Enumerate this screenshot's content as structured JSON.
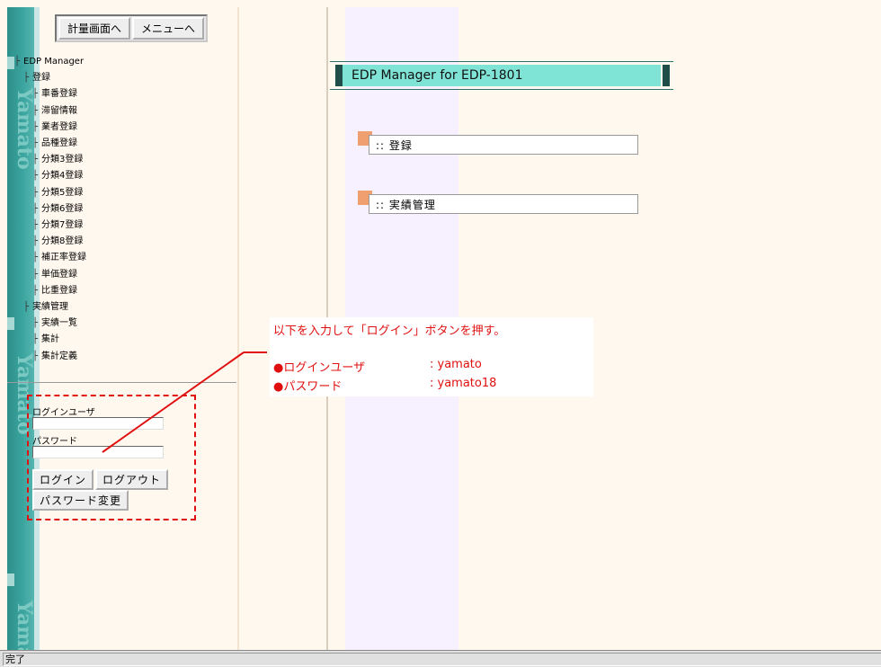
{
  "topbar": {
    "measure_btn": "計量画面へ",
    "menu_btn": "メニューへ"
  },
  "strip": {
    "watermark": "Yamato"
  },
  "tree": [
    {
      "label": "EDP  Manager",
      "level": 0
    },
    {
      "label": "登録",
      "level": 1
    },
    {
      "label": "車番登録",
      "level": 2
    },
    {
      "label": "滞留情報",
      "level": 2
    },
    {
      "label": "業者登録",
      "level": 2
    },
    {
      "label": "品種登録",
      "level": 2
    },
    {
      "label": "分類3登録",
      "level": 2
    },
    {
      "label": "分類4登録",
      "level": 2
    },
    {
      "label": "分類5登録",
      "level": 2
    },
    {
      "label": "分類6登録",
      "level": 2
    },
    {
      "label": "分類7登録",
      "level": 2
    },
    {
      "label": "分類8登録",
      "level": 2
    },
    {
      "label": "補正率登録",
      "level": 2
    },
    {
      "label": "単価登録",
      "level": 2
    },
    {
      "label": "比重登録",
      "level": 2
    },
    {
      "label": "実績管理",
      "level": 1
    },
    {
      "label": "実績一覧",
      "level": 2
    },
    {
      "label": "集計",
      "level": 2
    },
    {
      "label": "集計定義",
      "level": 2
    }
  ],
  "login": {
    "user_label": "ログインユーザ",
    "user_value": "",
    "password_label": "パスワード",
    "password_value": "",
    "login_btn": "ログイン",
    "logout_btn": "ログアウト",
    "change_pw_btn": "パスワード変更"
  },
  "header": {
    "title": "EDP Manager for EDP-1801"
  },
  "menu": {
    "register": ":: 登録",
    "results": ":: 実績管理"
  },
  "annotation": {
    "instruction": "以下を入力して「ログイン」ボタンを押す。",
    "user_label": "●ログインユーザ",
    "user_value": ": yamato",
    "password_label": "●パスワード",
    "password_value": ": yamato18"
  },
  "colors": {
    "teal_strip": "#3aa39d",
    "header_fill": "#7fe3d6",
    "annotation_red": "#e01010",
    "menu_square": "#f0a070"
  },
  "status": {
    "text": "完了"
  }
}
